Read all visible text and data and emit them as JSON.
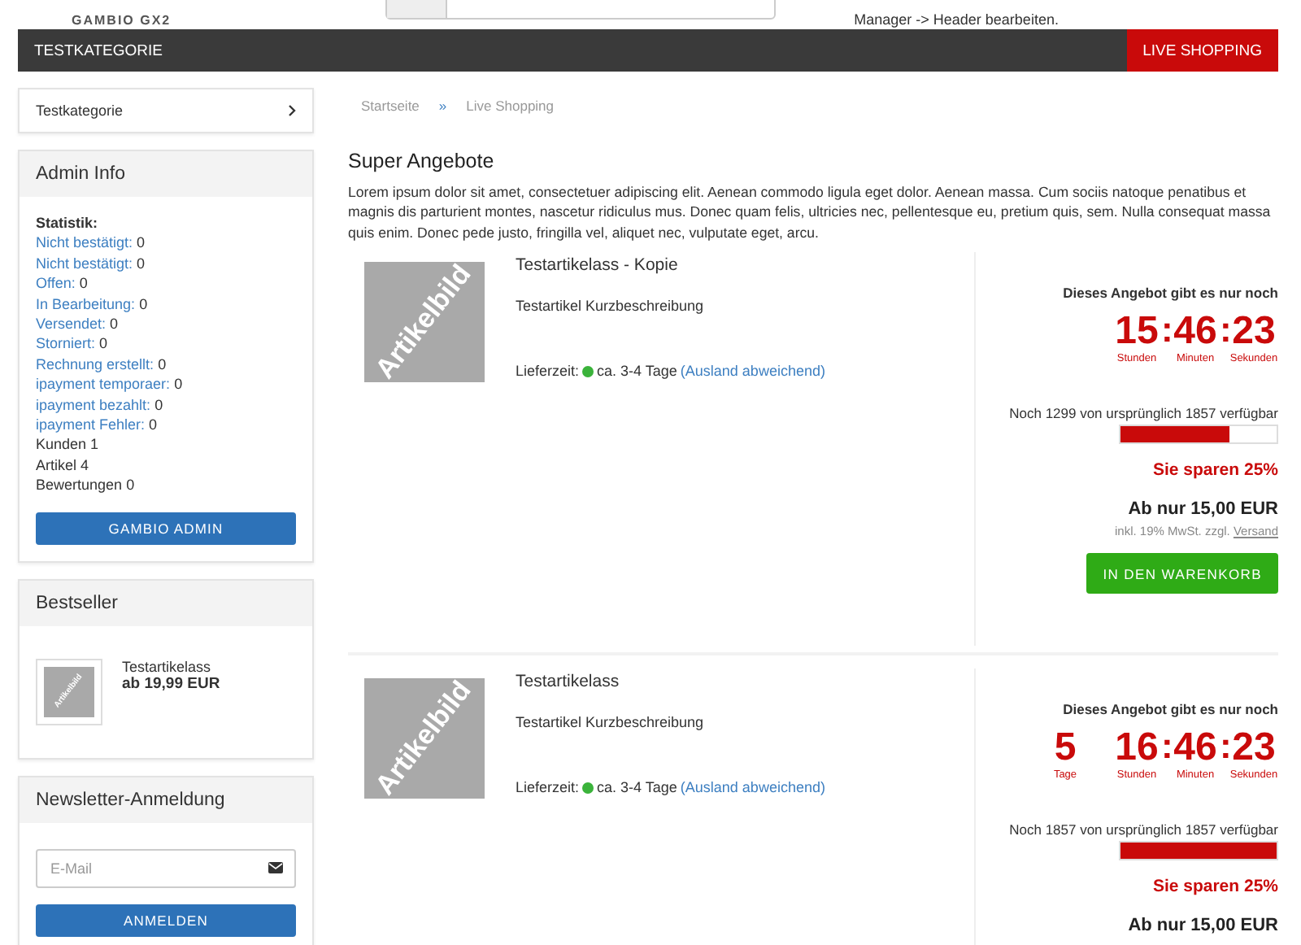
{
  "header": {
    "logo": "GAMBIO GX2",
    "note": "Manager -> Header bearbeiten."
  },
  "nav": {
    "items": [
      {
        "label": "TESTKATEGORIE",
        "selected": false
      },
      {
        "label": "LIVE SHOPPING",
        "selected": true
      }
    ]
  },
  "sidebar": {
    "category": "Testkategorie",
    "admin": {
      "title": "Admin Info",
      "heading": "Statistik:",
      "stats": [
        {
          "label": "Nicht bestätigt:",
          "value": "0",
          "linked": true
        },
        {
          "label": "Nicht bestätigt:",
          "value": "0",
          "linked": true
        },
        {
          "label": "Offen:",
          "value": "0",
          "linked": true
        },
        {
          "label": "In Bearbeitung:",
          "value": "0",
          "linked": true
        },
        {
          "label": "Versendet:",
          "value": "0",
          "linked": true
        },
        {
          "label": "Storniert:",
          "value": "0",
          "linked": true
        },
        {
          "label": "Rechnung erstellt:",
          "value": "0",
          "linked": true
        },
        {
          "label": "ipayment temporaer:",
          "value": "0",
          "linked": true
        },
        {
          "label": "ipayment bezahlt:",
          "value": "0",
          "linked": true
        },
        {
          "label": "ipayment Fehler:",
          "value": "0",
          "linked": true
        },
        {
          "label": "Kunden",
          "value": "1",
          "linked": false
        },
        {
          "label": "Artikel",
          "value": "4",
          "linked": false
        },
        {
          "label": "Bewertungen",
          "value": "0",
          "linked": false
        }
      ],
      "button": "GAMBIO ADMIN"
    },
    "bestseller": {
      "title": "Bestseller",
      "image_label": "Artikelbild",
      "name": "Testartikelass",
      "price": "ab 19,99 EUR"
    },
    "newsletter": {
      "title": "Newsletter-Anmeldung",
      "placeholder": "E-Mail",
      "button": "ANMELDEN"
    }
  },
  "breadcrumb": [
    "Startseite",
    "»",
    "Live Shopping"
  ],
  "page": {
    "title": "Super Angebote",
    "intro": "Lorem ipsum dolor sit amet, consectetuer adipiscing elit. Aenean commodo ligula eget dolor. Aenean massa. Cum sociis natoque penatibus et magnis dis parturient montes, nascetur ridiculus mus. Donec quam felis, ultricies nec, pellentesque eu, pretium quis, sem. Nulla consequat massa quis enim. Donec pede justo, fringilla vel, aliquet nec, vulputate eget, arcu."
  },
  "offers": [
    {
      "image_label": "Artikelbild",
      "title": "Testartikelass - Kopie",
      "description": "Testartikel Kurzbeschreibung",
      "delivery_label": "Lieferzeit:",
      "delivery_time": "ca. 3-4 Tage",
      "delivery_link": "(Ausland abweichend)",
      "countdown_title": "Dieses Angebot gibt es nur noch",
      "separator": ":",
      "countdown": [
        {
          "value": "15",
          "unit": "Stunden"
        },
        {
          "value": "46",
          "unit": "Minuten"
        },
        {
          "value": "23",
          "unit": "Sekunden"
        }
      ],
      "stock": "Noch 1299 von ursprünglich 1857 verfügbar",
      "level": 0.7,
      "savings": "Sie sparen 25%",
      "price": "Ab nur 15,00 EUR",
      "tax": "inkl. 19% MwSt. zzgl.",
      "shipping_link": "Versand",
      "button": "IN DEN WARENKORB"
    },
    {
      "image_label": "Artikelbild",
      "title": "Testartikelass",
      "description": "Testartikel Kurzbeschreibung",
      "delivery_label": "Lieferzeit:",
      "delivery_time": "ca. 3-4 Tage",
      "delivery_link": "(Ausland abweichend)",
      "countdown_title": "Dieses Angebot gibt es nur noch",
      "days": {
        "value": "5",
        "unit": "Tage"
      },
      "separator": ":",
      "countdown": [
        {
          "value": "16",
          "unit": "Stunden"
        },
        {
          "value": "46",
          "unit": "Minuten"
        },
        {
          "value": "23",
          "unit": "Sekunden"
        }
      ],
      "stock": "Noch 1857 von ursprünglich 1857 verfügbar",
      "level": 1,
      "savings": "Sie sparen 25%",
      "price": "Ab nur 15,00 EUR"
    }
  ]
}
